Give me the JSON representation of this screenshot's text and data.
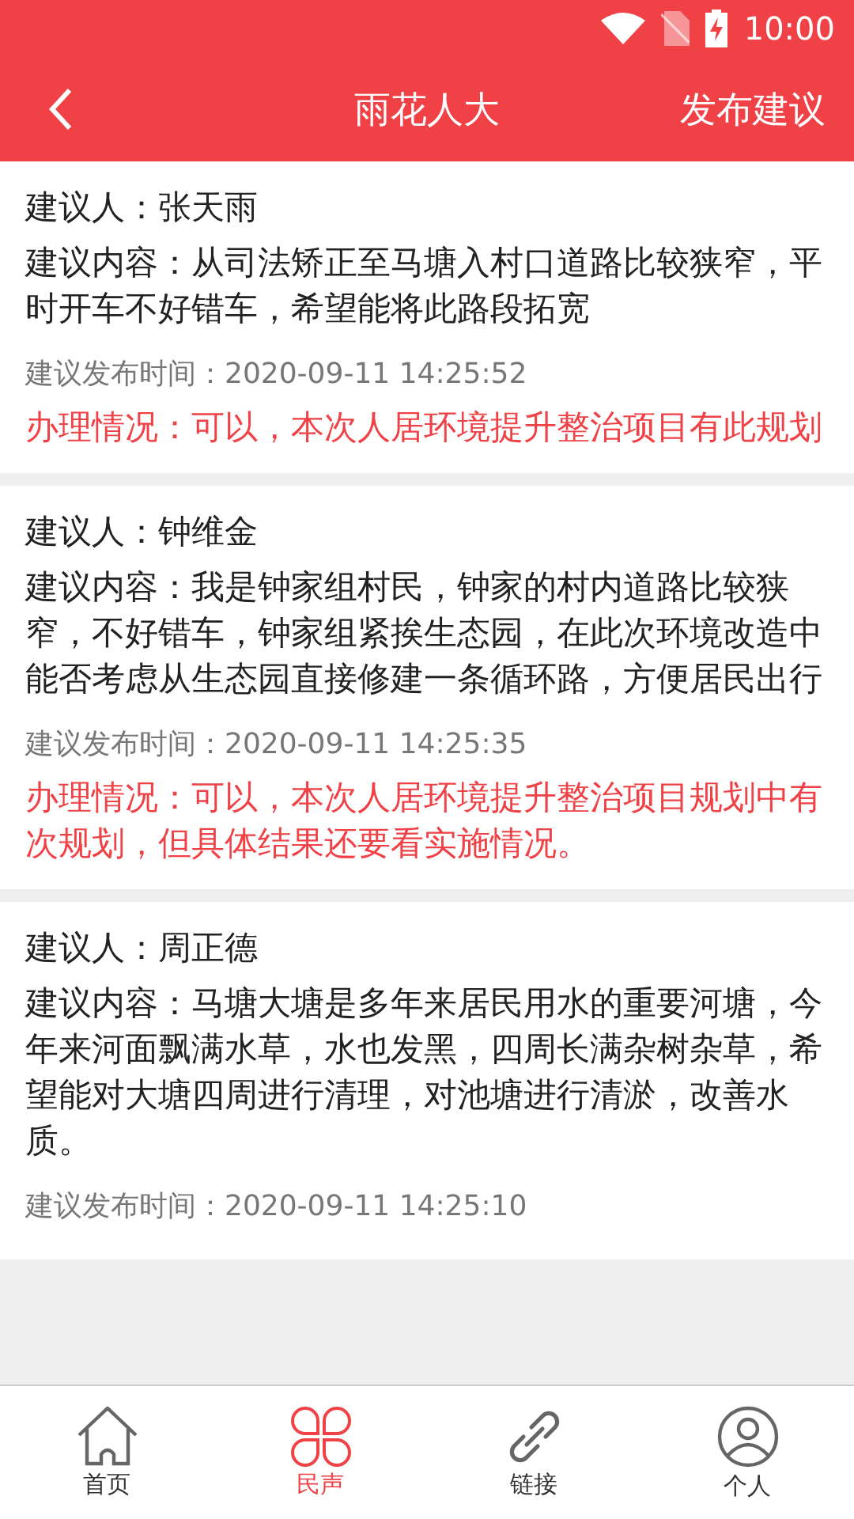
{
  "status_bar": {
    "time": "10:00"
  },
  "header": {
    "title": "雨花人大",
    "action": "发布建议"
  },
  "suggestions": [
    {
      "proposer": "建议人：张天雨",
      "content": "建议内容：从司法矫正至马塘入村口道路比较狭窄，平时开车不好错车，希望能将此路段拓宽",
      "time": "建议发布时间：2020-09-11 14:25:52",
      "handling": "办理情况：可以，本次人居环境提升整治项目有此规划"
    },
    {
      "proposer": "建议人：钟维金",
      "content": "建议内容：我是钟家组村民，钟家的村内道路比较狭窄，不好错车，钟家组紧挨生态园，在此次环境改造中能否考虑从生态园直接修建一条循环路，方便居民出行",
      "time": "建议发布时间：2020-09-11 14:25:35",
      "handling": "办理情况：可以，本次人居环境提升整治项目规划中有次规划，但具体结果还要看实施情况。"
    },
    {
      "proposer": "建议人：周正德",
      "content": "建议内容：马塘大塘是多年来居民用水的重要河塘，今年来河面飘满水草，水也发黑，四周长满杂树杂草，希望能对大塘四周进行清理，对池塘进行清淤，改善水质。",
      "time": "建议发布时间：2020-09-11 14:25:10"
    }
  ],
  "nav": [
    {
      "kind": "home",
      "label": "首页",
      "selected": false
    },
    {
      "kind": "voice",
      "label": "民声",
      "selected": true
    },
    {
      "kind": "link",
      "label": "链接",
      "selected": false
    },
    {
      "kind": "person",
      "label": "个人",
      "selected": false
    }
  ]
}
